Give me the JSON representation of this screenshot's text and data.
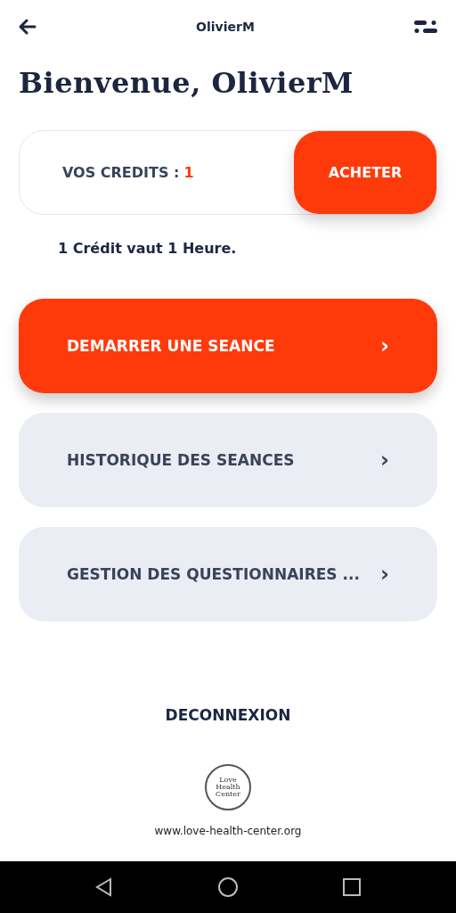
{
  "header": {
    "title": "OlivierM"
  },
  "greeting": "Bienvenue, OlivierM",
  "credits": {
    "label": "VOS CREDITS :",
    "value": "1",
    "button": "ACHETER"
  },
  "credit_note": "1 Crédit vaut 1 Heure.",
  "menu": [
    {
      "label": "DEMARRER UNE SEANCE",
      "kind": "primary",
      "chevron": "›"
    },
    {
      "label": "HISTORIQUE DES SEANCES",
      "kind": "secondary",
      "chevron": "›"
    },
    {
      "label": "GESTION DES QUESTIONNAIRES ...",
      "kind": "secondary",
      "chevron": "›"
    }
  ],
  "logout": "DECONNEXION",
  "footer": {
    "logo_lines": [
      "Love",
      "Health",
      "Center"
    ],
    "url": "www.love-health-center.org"
  }
}
